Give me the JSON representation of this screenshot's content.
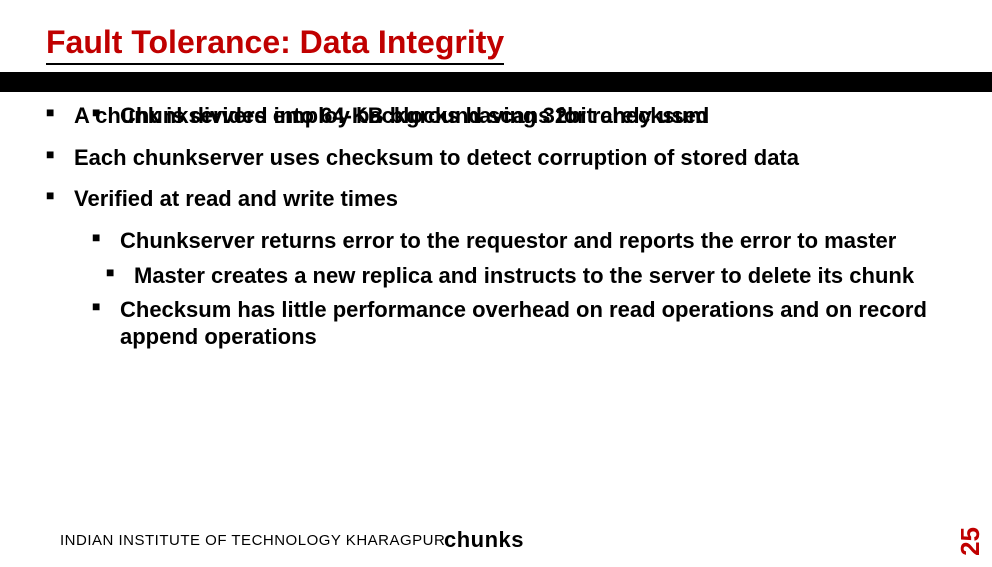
{
  "title": "Fault Tolerance: Data Integrity",
  "bullets": {
    "b1": "A chunk is divided into 64-KB blocks having 32bit  checksum",
    "b2": "Each chunkserver uses checksum to detect corruption of stored data",
    "b3": "Verified at read and write times",
    "b4": "Chunkserver returns error to the requestor and reports the error to master",
    "b5": "Master creates a new replica and instructs to the server to delete its chunk",
    "b6": "Checksum has little performance overhead on read operations and on record append operations",
    "b7": "Chunkservers employ background scans for rarely used"
  },
  "footer_institute": "INDIAN INSTITUTE OF TECHNOLOGY KHARAGPUR",
  "footer_chunks": "chunks",
  "page_number": "25"
}
